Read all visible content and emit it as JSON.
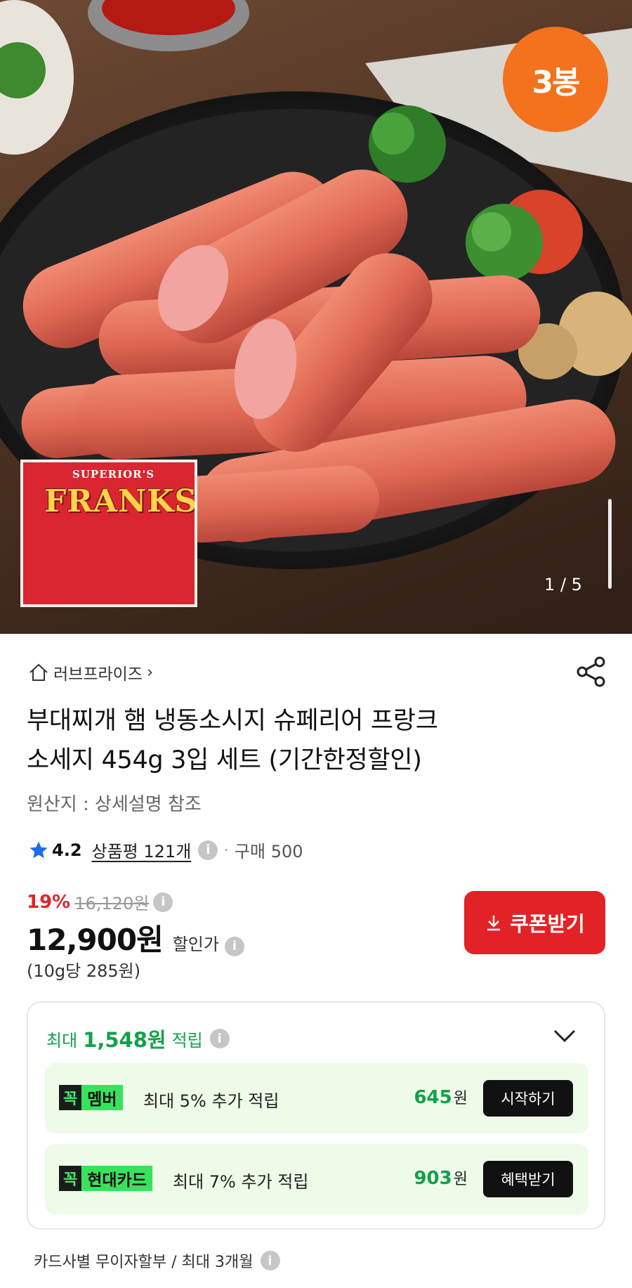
{
  "hero": {
    "badge": "3봉",
    "counter": "1 / 5",
    "package_brand": "SUPERIOR'S",
    "package_logo": "FRANKS"
  },
  "store": {
    "name": "러브프라이즈",
    "chevron": "›",
    "share_icon": "share-icon"
  },
  "product": {
    "title_line1": "부대찌개 햄 냉동소시지 슈페리어 프랑크",
    "title_line2": "소세지 454g 3입 세트 (기간한정할인)",
    "origin": "원산지 : 상세설명 참조"
  },
  "rating": {
    "score": "4.2",
    "reviews": "상품평 121개",
    "separator": "·",
    "purchases": "구매 500"
  },
  "price": {
    "discount": "19%",
    "original": "16,120원",
    "current": "12,900원",
    "label": "할인가",
    "unit": "(10g당 285원)",
    "coupon_button": "쿠폰받기"
  },
  "points": {
    "prefix": "최대",
    "amount": "1,548원",
    "suffix": "적립",
    "offers": [
      {
        "kkok": "꼭",
        "name": "멤버",
        "desc": "최대 5% 추가 적립",
        "amount": "645",
        "unit": "원",
        "action": "시작하기"
      },
      {
        "kkok": "꼭",
        "name": "현대카드",
        "desc": "최대 7% 추가 적립",
        "amount": "903",
        "unit": "원",
        "action": "혜택받기"
      }
    ]
  },
  "installment": "카드사별 무이자할부 / 최대 3개월",
  "info_glyph": "i",
  "colors": {
    "accent_red": "#e32227",
    "badge_orange": "#f4711d",
    "points_green": "#12a14b",
    "offer_bg": "#eefbe8"
  }
}
